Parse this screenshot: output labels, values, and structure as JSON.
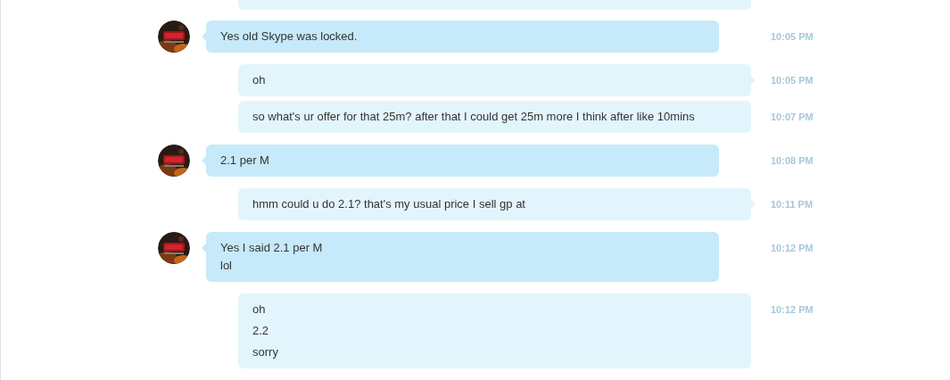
{
  "messages": [
    {
      "kind": "incoming",
      "tail": true,
      "paragraphs": [
        "Yes old Skype was locked."
      ],
      "time": "10:05 PM"
    },
    {
      "kind": "outgoing",
      "tail": true,
      "paragraphs": [
        "oh"
      ],
      "time": "10:05 PM"
    },
    {
      "kind": "outgoing",
      "tail": false,
      "paragraphs": [
        "so what's ur offer for that 25m? after that I could get 25m more I think after like 10mins"
      ],
      "time": "10:07 PM"
    },
    {
      "kind": "incoming",
      "tail": true,
      "paragraphs": [
        "2.1 per M"
      ],
      "time": "10:08 PM"
    },
    {
      "kind": "outgoing",
      "tail": true,
      "paragraphs": [
        "hmm could u do 2.1? that's my usual price I sell gp at"
      ],
      "time": "10:11 PM"
    },
    {
      "kind": "incoming",
      "tail": true,
      "paragraphs": [
        "Yes I said 2.1 per M\nlol"
      ],
      "time": "10:12 PM"
    },
    {
      "kind": "outgoing",
      "tail": false,
      "paragraphs": [
        "oh",
        "2.2",
        "sorry"
      ],
      "time": "10:12 PM"
    }
  ]
}
